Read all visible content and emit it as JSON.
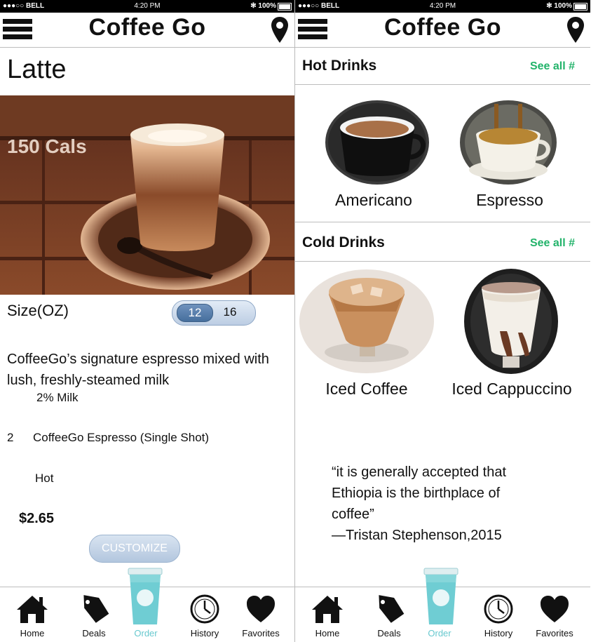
{
  "status_bar": {
    "carrier": "●●●○○ BELL",
    "time": "4:20 PM",
    "battery": "✻ 100%"
  },
  "app": {
    "title": "Coffee Go"
  },
  "detail": {
    "drink_name": "Latte",
    "calories": "150 Cals",
    "size_label": "Size(OZ)",
    "size_options": [
      "12",
      "16"
    ],
    "selected_size": "12",
    "description": "CoffeeGo’s signature espresso mixed with lush, freshly-steamed milk",
    "milk": "2% Milk",
    "shot_count": "2",
    "shot_label": "CoffeeGo Espresso (Single Shot)",
    "temperature": "Hot",
    "price": "$2.65",
    "customize_label": "CUSTOMIZE"
  },
  "menu": {
    "hot": {
      "title": "Hot Drinks",
      "see_all": "See all #",
      "items": [
        "Americano",
        "Espresso"
      ]
    },
    "cold": {
      "title": "Cold Drinks",
      "see_all": "See all #",
      "items": [
        "Iced Coffee",
        "Iced Cappuccino"
      ]
    },
    "quote": {
      "line1": "“it is generally accepted that",
      "line2": "Ethiopia is the birthplace of",
      "line3": "coffee”",
      "line4": "—Tristan Stephenson,2015"
    }
  },
  "nav": {
    "home": "Home",
    "deals": "Deals",
    "order": "Order",
    "history": "History",
    "favorites": "Favorites",
    "active": "order"
  },
  "colors": {
    "accent_green": "#22b36a",
    "order_teal": "#68c9cf",
    "toggle_blue": "#466f9d"
  },
  "icons": {
    "menu": "hamburger-icon",
    "location": "map-pin-icon",
    "home": "house-icon",
    "deals": "tag-icon",
    "order": "cup-icon",
    "history": "clock-icon",
    "favorites": "heart-icon"
  }
}
